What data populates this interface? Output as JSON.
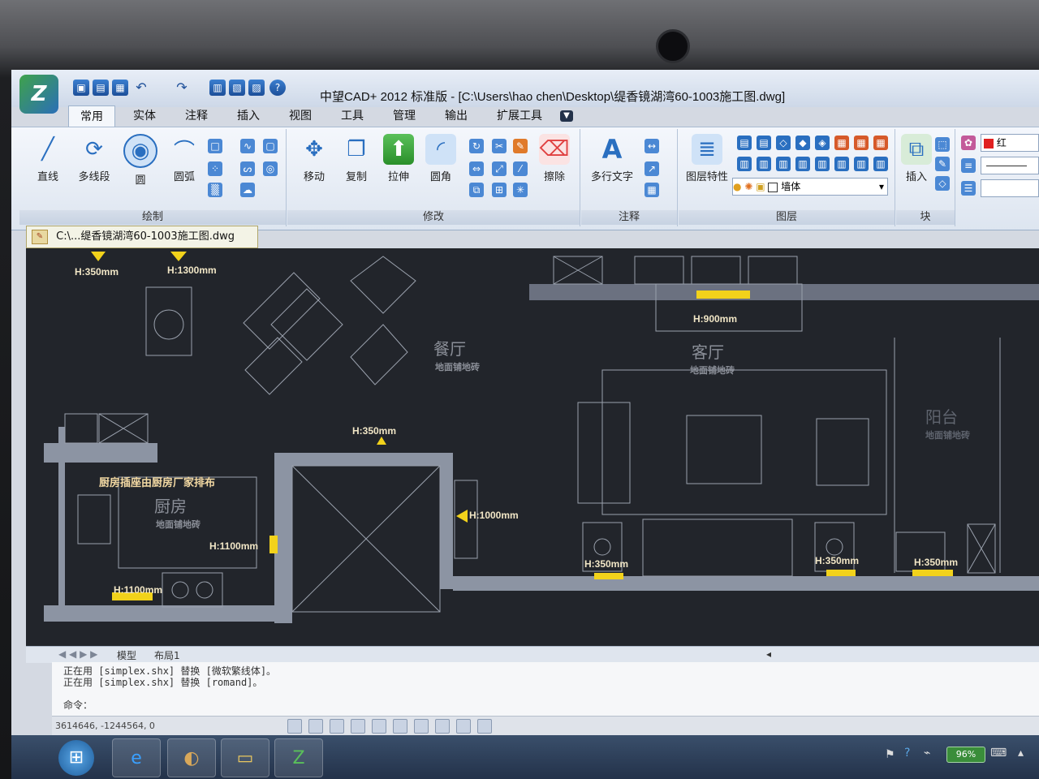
{
  "window": {
    "title": "中望CAD+ 2012 标准版 - [C:\\Users\\hao chen\\Desktop\\缇香镜湖湾60-1003施工图.dwg]"
  },
  "ribbon_tabs": [
    "常用",
    "实体",
    "注释",
    "插入",
    "视图",
    "工具",
    "管理",
    "输出",
    "扩展工具"
  ],
  "ribbon": {
    "draw": {
      "label": "绘制",
      "tools": [
        "直线",
        "多线段",
        "圆",
        "圆弧"
      ]
    },
    "modify": {
      "label": "修改",
      "tools": [
        "移动",
        "复制",
        "拉伸",
        "圆角",
        "擦除"
      ]
    },
    "annotate": {
      "label": "注释",
      "tools": [
        "多行文字"
      ]
    },
    "layers": {
      "label": "图层",
      "tools": [
        "图层特性"
      ],
      "current_layer": "墙体"
    },
    "block": {
      "label": "块",
      "tools": [
        "插入"
      ]
    },
    "properties": {
      "color": "红",
      "color_hex": "#e02020"
    }
  },
  "document_tab": "C:\\...缇香镜湖湾60-1003施工图.dwg",
  "drawing": {
    "rooms": [
      {
        "name": "餐厅",
        "sub": "地面铺地砖"
      },
      {
        "name": "客厅",
        "sub": "地面铺地砖"
      },
      {
        "name": "阳台",
        "sub": "地面铺地砖"
      },
      {
        "name": "厨房",
        "sub": "地面铺地砖"
      }
    ],
    "note": "厨房插座由厨房厂家排布",
    "labels": [
      "H:350mm",
      "H:1300mm",
      "H:900mm",
      "H:350mm",
      "H:1000mm",
      "H:1100mm",
      "H:1100mm",
      "H:350mm",
      "H:350mm",
      "H:350mm"
    ]
  },
  "layout_tabs": [
    "模型",
    "布局1"
  ],
  "command": {
    "lines": [
      "正在用 [simplex.shx] 替换 [微软繁线体]。",
      "正在用 [simplex.shx] 替换 [romand]。"
    ],
    "prompt": "命令："
  },
  "status": {
    "coords": "3614646, -1244564, 0"
  },
  "taskbar": {
    "battery": "96%"
  }
}
